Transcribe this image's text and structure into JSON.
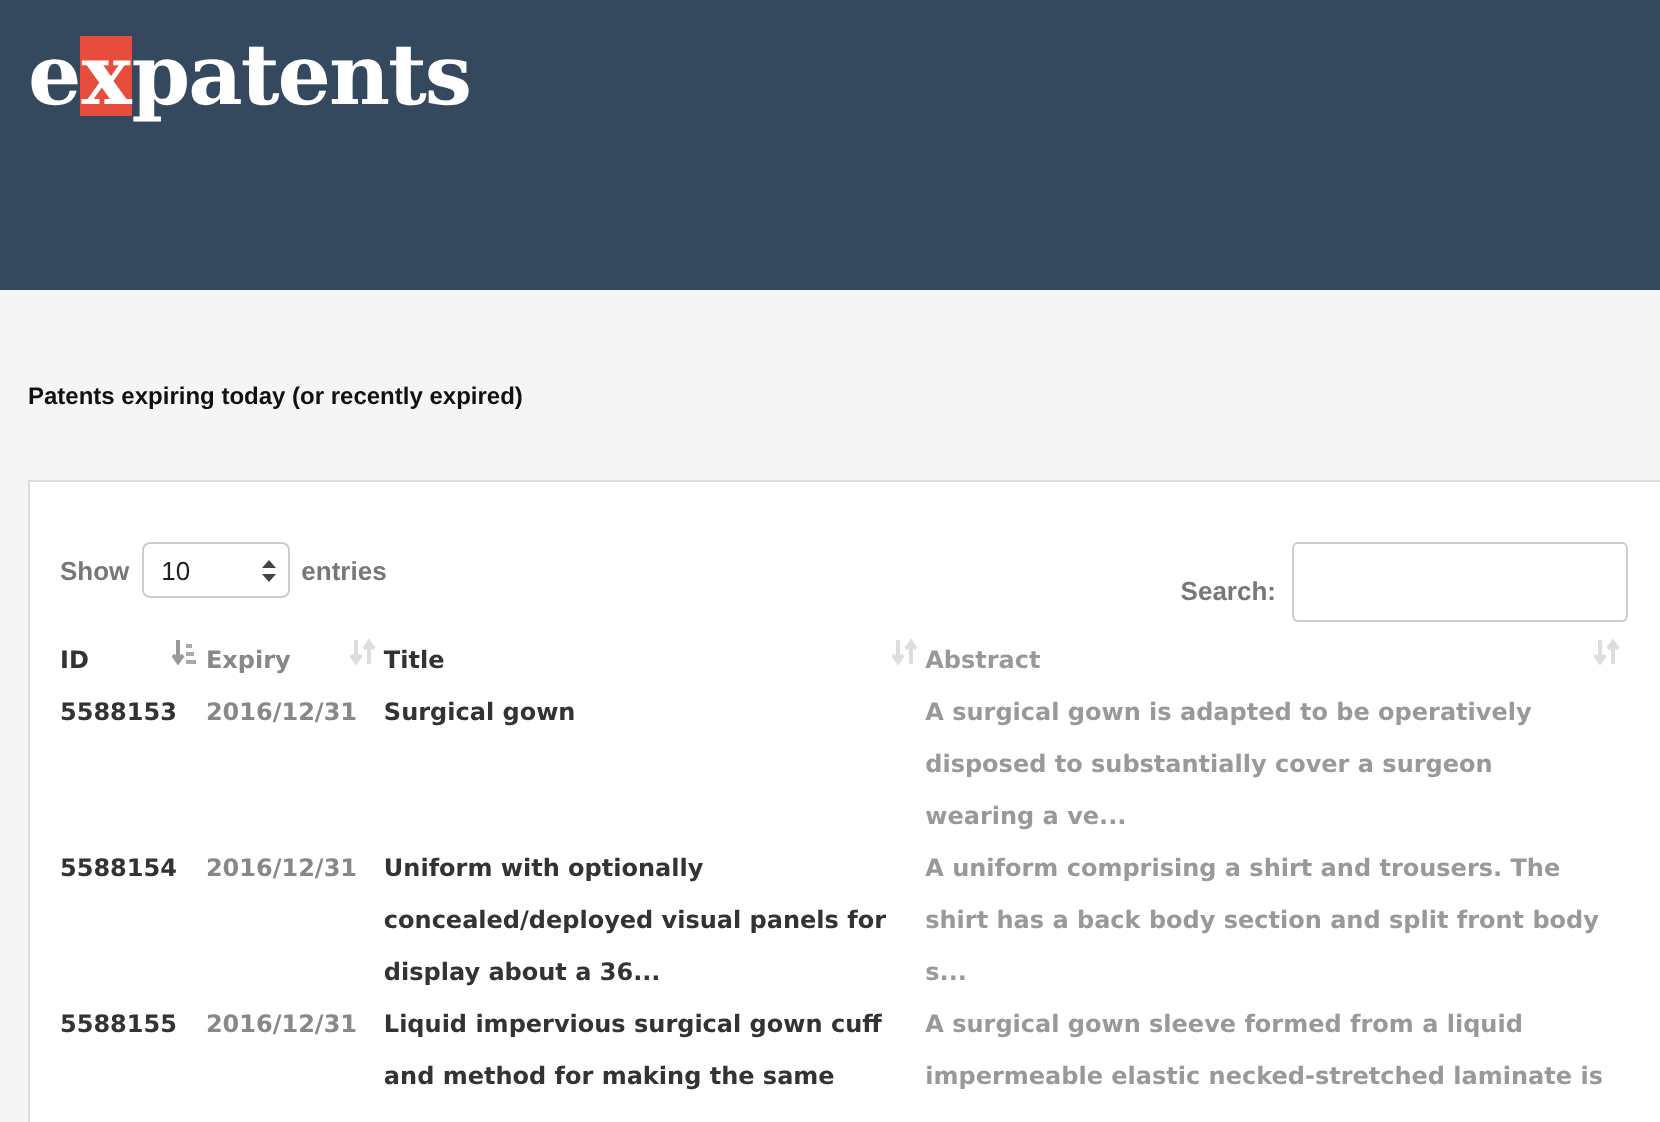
{
  "logo": {
    "parts": [
      {
        "text": "e",
        "highlight": false
      },
      {
        "text": "x",
        "highlight": true
      },
      {
        "text": "patents",
        "highlight": false
      }
    ]
  },
  "heading": "Patents expiring today (or recently expired)",
  "length_control": {
    "before": "Show",
    "value": "10",
    "after": "entries"
  },
  "search": {
    "label": "Search:"
  },
  "table": {
    "columns": [
      {
        "label": "ID",
        "sorted": true
      },
      {
        "label": "Expiry",
        "sorted": false
      },
      {
        "label": "Title",
        "sorted": false
      },
      {
        "label": "Abstract",
        "sorted": false
      }
    ],
    "rows": [
      {
        "id": "5588153",
        "expiry": "2016/12/31",
        "title": "Surgical gown",
        "abstract": "A surgical gown is adapted to be operatively disposed to substantially cover a surgeon wearing a ve..."
      },
      {
        "id": "5588154",
        "expiry": "2016/12/31",
        "title": "Uniform with optionally concealed/deployed visual panels for display about a 36...",
        "abstract": "A uniform comprising a shirt and trousers. The shirt has a back body section and split front body s..."
      },
      {
        "id": "5588155",
        "expiry": "2016/12/31",
        "title": "Liquid impervious surgical gown cuff and method for making the same",
        "abstract": "A surgical gown sleeve formed from a liquid impermeable elastic necked-stretched laminate is"
      }
    ]
  }
}
